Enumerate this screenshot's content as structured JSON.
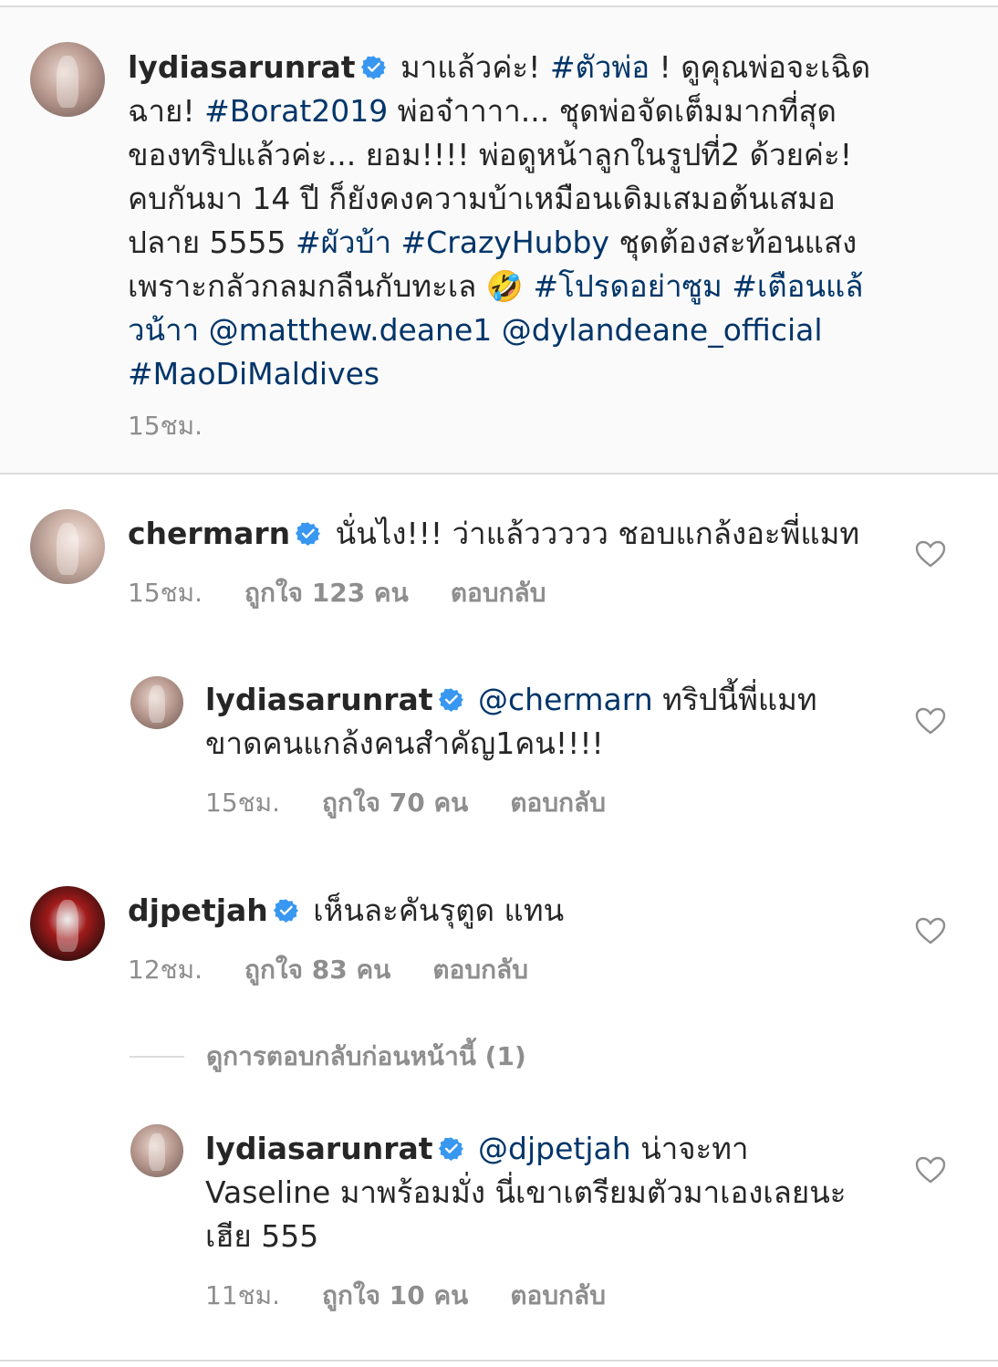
{
  "caption": {
    "username": "lydiasarunrat",
    "segments": [
      {
        "t": "มาแล้วค่ะ! ",
        "tag": false
      },
      {
        "t": "#ตัวพ่อ",
        "tag": true
      },
      {
        "t": " ! ดูคุณพ่อจะเฉิดฉาย! ",
        "tag": false
      },
      {
        "t": "#Borat2019",
        "tag": true
      },
      {
        "t": " พ่อจ๋าาาา... ชุดพ่อจัดเต็มมากที่สุดของทริปแล้วค่ะ... ยอม!!!! พ่อดูหน้าลูกในรูปที่2 ด้วยค่ะ! คบกันมา 14 ปี ก็ยังคงความบ้าเหมือนเดิมเสมอต้นเสมอปลาย 5555 ",
        "tag": false
      },
      {
        "t": "#ผัวบ้า",
        "tag": true
      },
      {
        "t": " ",
        "tag": false
      },
      {
        "t": "#CrazyHubby",
        "tag": true
      },
      {
        "t": " ชุดต้องสะท้อนแสงเพราะกลัวกลมกลืนกับทะเล 🤣 ",
        "tag": false
      },
      {
        "t": "#โปรดอย่าซูม",
        "tag": true
      },
      {
        "t": " ",
        "tag": false
      },
      {
        "t": "#เตือนแล้วน้าา",
        "tag": true
      },
      {
        "t": " ",
        "tag": false
      },
      {
        "t": "@matthew.deane1",
        "tag": true
      },
      {
        "t": " ",
        "tag": false
      },
      {
        "t": "@dylandeane_official",
        "tag": true
      },
      {
        "t": " ",
        "tag": false
      },
      {
        "t": "#MaoDiMaldives",
        "tag": true
      }
    ],
    "time": "15ชม."
  },
  "comments": [
    {
      "username": "chermarn",
      "segments": [
        {
          "t": "นั่นไง!!! ว่าแล้ววววว ชอบแกล้งอะพี่แมท",
          "tag": false
        }
      ],
      "time": "15ชม.",
      "likes": "ถูกใจ 123 คน",
      "reply": "ตอบกลับ"
    },
    {
      "username": "lydiasarunrat",
      "segments": [
        {
          "t": "@chermarn",
          "tag": true
        },
        {
          "t": " ทริปนี้พี่แมทขาดคนแกล้งคนสำคัญ1คน!!!!",
          "tag": false
        }
      ],
      "time": "15ชม.",
      "likes": "ถูกใจ 70 คน",
      "reply": "ตอบกลับ"
    },
    {
      "username": "djpetjah",
      "segments": [
        {
          "t": "เห็นละคันรุตูด แทน",
          "tag": false
        }
      ],
      "time": "12ชม.",
      "likes": "ถูกใจ 83 คน",
      "reply": "ตอบกลับ"
    },
    {
      "username": "lydiasarunrat",
      "segments": [
        {
          "t": "@djpetjah",
          "tag": true
        },
        {
          "t": " น่าจะทา Vaseline มาพร้อมมั่ง นี่เขาเตรียมตัวมาเองเลยนะเฮีย 555",
          "tag": false
        }
      ],
      "time": "11ชม.",
      "likes": "ถูกใจ 10 คน",
      "reply": "ตอบกลับ"
    }
  ],
  "view_previous_replies": "ดูการตอบกลับก่อนหน้านี้ (1)",
  "colors": {
    "verified": "#3897f0",
    "link": "#003569",
    "meta": "#8e8e8e",
    "divider": "#dbdbdb"
  },
  "icons": {
    "verified": "verified-badge-icon",
    "like": "heart-outline-icon"
  }
}
